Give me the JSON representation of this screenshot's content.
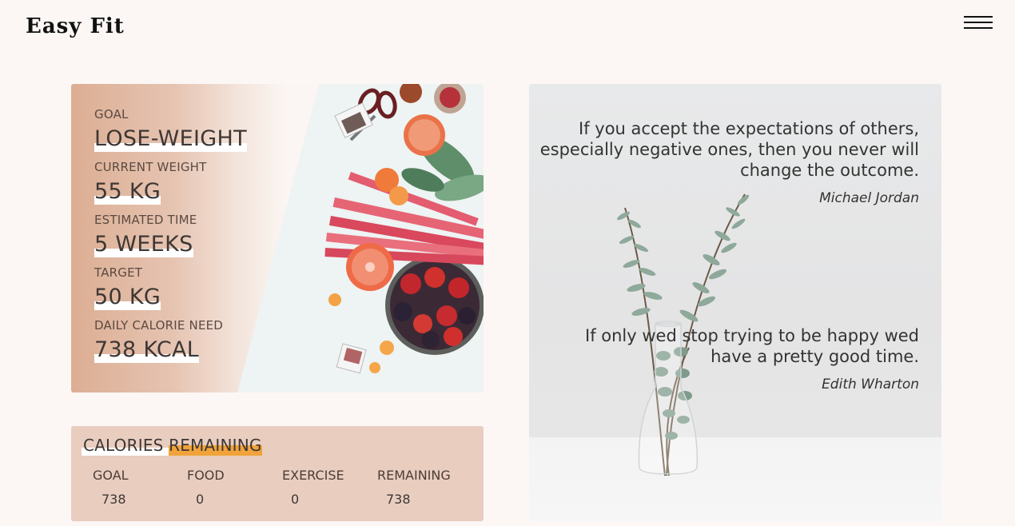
{
  "header": {
    "logo": "Easy Fit",
    "menu_icon": "hamburger-menu-icon"
  },
  "goal_card": {
    "items": [
      {
        "label": "GOAL",
        "value": "LOSE-WEIGHT"
      },
      {
        "label": "CURRENT WEIGHT",
        "value": "55 KG"
      },
      {
        "label": "ESTIMATED TIME",
        "value": "5 WEEKS"
      },
      {
        "label": "TARGET",
        "value": "50 KG"
      },
      {
        "label": "DAILY CALORIE NEED",
        "value": "738 KCAL"
      }
    ]
  },
  "calories": {
    "title_part1": "CALORIES ",
    "title_part2": "REMAINING",
    "columns": [
      {
        "header": "GOAL",
        "value": "738"
      },
      {
        "header": "FOOD",
        "value": "0"
      },
      {
        "header": "EXERCISE",
        "value": "0"
      },
      {
        "header": "REMAINING",
        "value": "738"
      }
    ]
  },
  "quotes": [
    {
      "lines": [
        "If you accept the expectations of others,",
        "especially negative ones, then you never will",
        "change the outcome."
      ],
      "author": "Michael Jordan"
    },
    {
      "lines": [
        "If only wed stop trying to be happy wed",
        "have a pretty good time."
      ],
      "author": "Edith Wharton"
    }
  ],
  "colors": {
    "background": "#fcf7f5",
    "card_peach": "#e9cdbf",
    "highlight_orange": "#f0a33a"
  }
}
